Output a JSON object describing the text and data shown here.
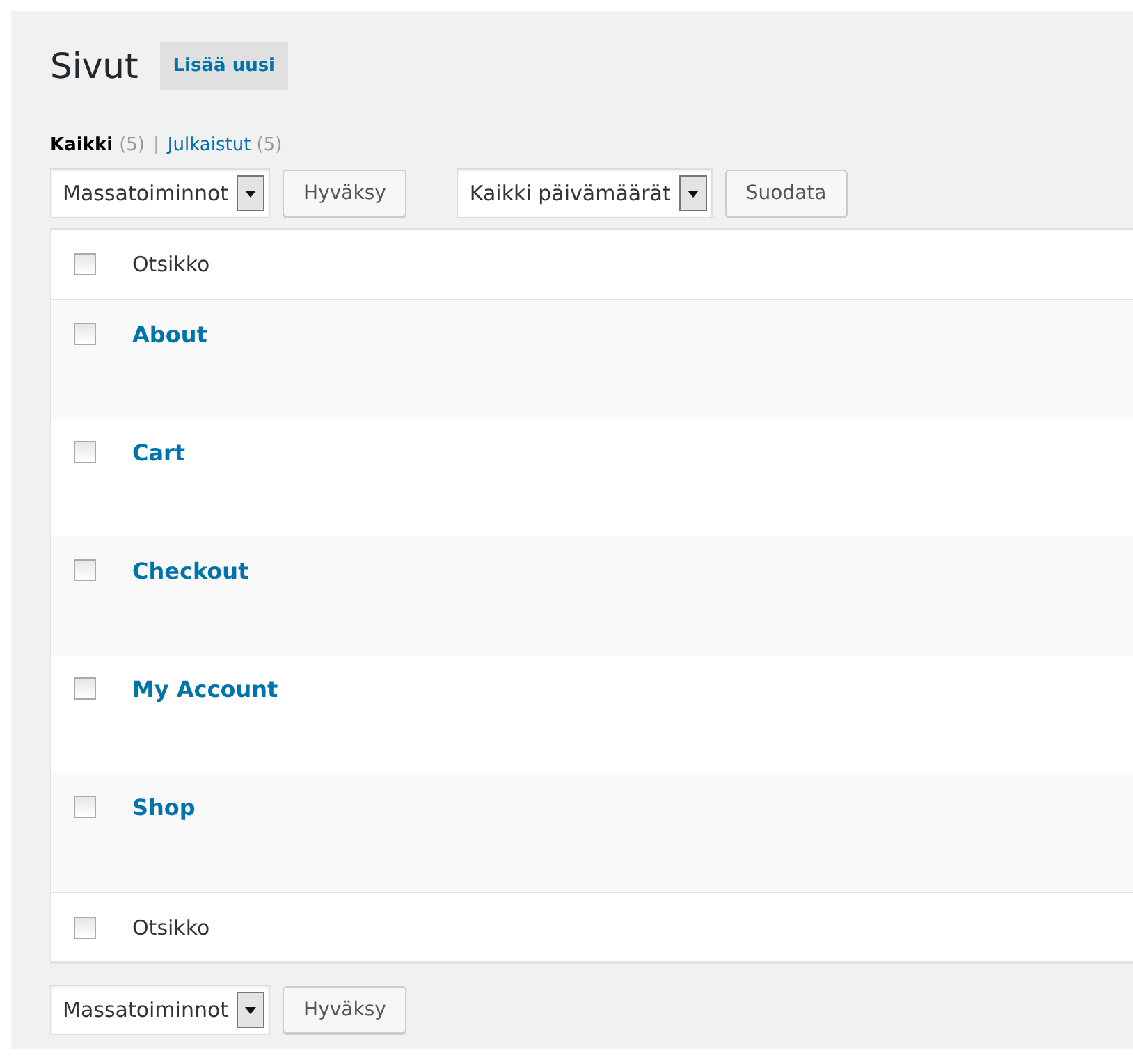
{
  "header": {
    "title": "Sivut",
    "add_button": "Lisää uusi"
  },
  "views": [
    {
      "label": "Kaikki",
      "count": "(5)",
      "selected": true
    },
    {
      "label": "Julkaistut",
      "count": "(5)",
      "selected": false
    }
  ],
  "views_separator": "|",
  "top_toolbar": {
    "bulk_select": "Massatoiminnot",
    "apply_button": "Hyväksy",
    "date_select": "Kaikki päivämäärät",
    "filter_button": "Suodata"
  },
  "table": {
    "header": {
      "label": "Otsikko",
      "checked": false
    },
    "rows": [
      {
        "title": "About",
        "checked": false
      },
      {
        "title": "Cart",
        "checked": false
      },
      {
        "title": "Checkout",
        "checked": false
      },
      {
        "title": "My Account",
        "checked": false
      },
      {
        "title": "Shop",
        "checked": false
      }
    ],
    "footer": {
      "label": "Otsikko",
      "checked": false
    }
  },
  "bottom_toolbar": {
    "bulk_select": "Massatoiminnot",
    "apply_button": "Hyväksy"
  }
}
